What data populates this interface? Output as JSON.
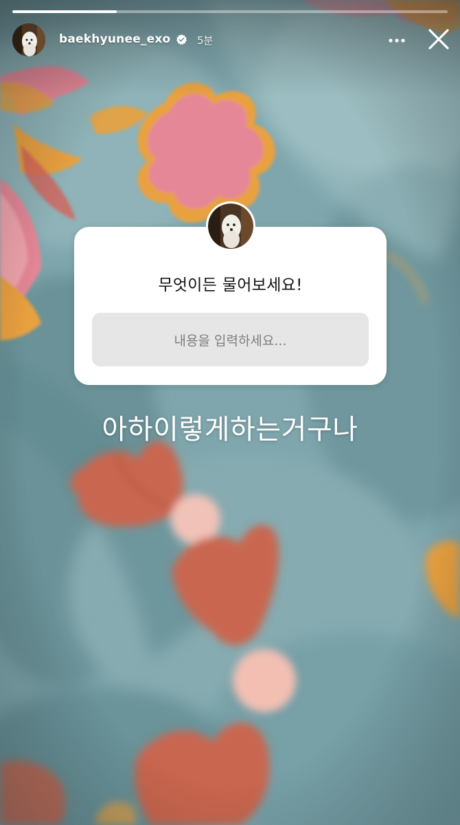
{
  "story": {
    "progress_fraction": 0.24,
    "username": "baekhyunee_exo",
    "time_ago": "5분",
    "icons": {
      "verified": "verified-badge-icon",
      "more": "more-options-icon",
      "close": "close-icon"
    }
  },
  "question_sticker": {
    "title": "무엇이든 물어보세요!",
    "placeholder": "내용을 입력하세요..."
  },
  "caption": "아하이렇게하는거구나",
  "colors": {
    "fabric_base": "#7fa6ad",
    "flower_pink": "#e6879a",
    "flower_orange": "#e9a13f",
    "leaf_rust": "#c9664f"
  }
}
